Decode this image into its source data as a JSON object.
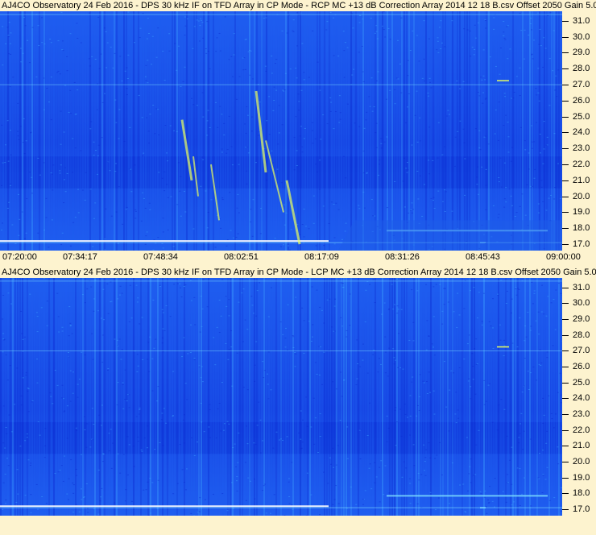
{
  "charts": [
    {
      "title": "AJ4CO Observatory 24 Feb 2016 - DPS 30 kHz IF on TFD Array in CP Mode - RCP  MC +13 dB  Correction Array 2014 12 18 B.csv  Offset 2050  Gain 5.0"
    },
    {
      "title": "AJ4CO Observatory 24 Feb 2016 - DPS 30 kHz IF on TFD Array in CP Mode - LCP  MC +13 dB  Correction Array 2014 12 18 B.csv  Offset 2050  Gain 5.0"
    }
  ],
  "chart_data": [
    {
      "type": "heatmap",
      "title": "AJ4CO Observatory 24 Feb 2016 - DPS 30 kHz IF on TFD Array in CP Mode - RCP  MC +13 dB  Correction Array 2014 12 18 B.csv  Offset 2050  Gain 5.0",
      "x_ticks": [
        "07:20:00",
        "07:34:17",
        "07:48:34",
        "08:02:51",
        "08:17:09",
        "08:31:26",
        "08:45:43",
        "09:00:00"
      ],
      "y_ticks": [
        "17.0",
        "18.0",
        "19.0",
        "20.0",
        "21.0",
        "22.0",
        "23.0",
        "24.0",
        "25.0",
        "26.0",
        "27.0",
        "28.0",
        "29.0",
        "30.0",
        "31.0"
      ],
      "ylim": [
        16.6,
        31.6
      ],
      "colormap": [
        "#0a2ad0",
        "#1f5ef0",
        "#3fa6ff",
        "#7fe0ff",
        "#e8ff60"
      ]
    },
    {
      "type": "heatmap",
      "title": "AJ4CO Observatory 24 Feb 2016 - DPS 30 kHz IF on TFD Array in CP Mode - LCP  MC +13 dB  Correction Array 2014 12 18 B.csv  Offset 2050  Gain 5.0",
      "x_ticks": [],
      "y_ticks": [
        "17.0",
        "18.0",
        "19.0",
        "20.0",
        "21.0",
        "22.0",
        "23.0",
        "24.0",
        "25.0",
        "26.0",
        "27.0",
        "28.0",
        "29.0",
        "30.0",
        "31.0"
      ],
      "ylim": [
        16.6,
        31.6
      ],
      "colormap": [
        "#0a2ad0",
        "#1f5ef0",
        "#3fa6ff",
        "#7fe0ff",
        "#e8ff60"
      ]
    }
  ]
}
